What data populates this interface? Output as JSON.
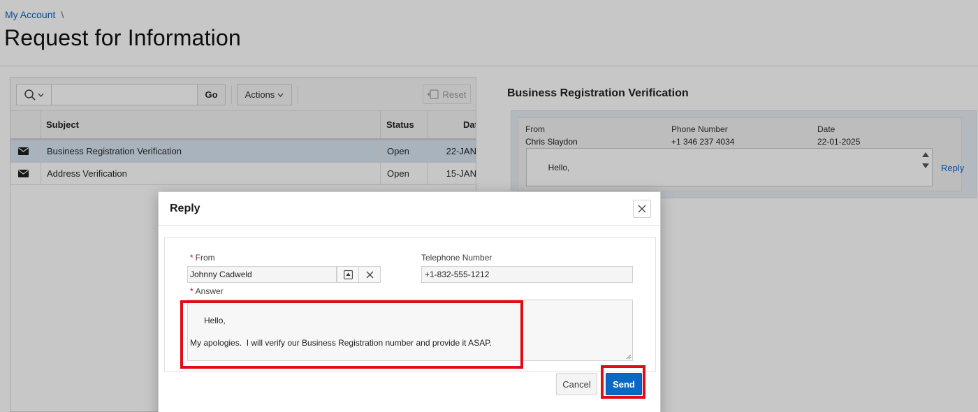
{
  "breadcrumb": {
    "link": "My Account",
    "separator": "\\"
  },
  "page_title": "Request for Information",
  "toolbar": {
    "search_placeholder": "",
    "go_label": "Go",
    "actions_label": "Actions",
    "reset_label": "Reset"
  },
  "grid": {
    "columns": [
      "",
      "Subject",
      "Status",
      "Dat"
    ],
    "rows": [
      {
        "subject": "Business Registration Verification",
        "status": "Open",
        "date": "22-JAN"
      },
      {
        "subject": "Address Verification",
        "status": "Open",
        "date": "15-JAN"
      }
    ]
  },
  "detail": {
    "title": "Business Registration Verification",
    "labels": {
      "from": "From",
      "phone": "Phone Number",
      "date": "Date"
    },
    "from": "Chris Slaydon",
    "phone": "+1 346 237 4034",
    "date": "22-01-2025",
    "message": "Hello,\n\nCould you please verify the Business Registration number provided?  The number provided during the",
    "reply_link": "Reply"
  },
  "dialog": {
    "title": "Reply",
    "from_label": "From",
    "from_value": "Johnny Cadweld",
    "tel_label": "Telephone Number",
    "tel_value": "+1-832-555-1212",
    "answer_label": "Answer",
    "answer_value": "Hello,\n\nMy apologies.  I will verify our Business Registration number and provide it ASAP.\n\nThank you!",
    "cancel_label": "Cancel",
    "send_label": "Send",
    "required_marker": "*"
  },
  "colors": {
    "accent": "#0a68c5",
    "link": "#0b64c0",
    "highlight": "#e10d16",
    "selected_row": "#d9e6f3"
  },
  "icons": [
    "search-icon",
    "chevron-down-icon",
    "reset-icon",
    "mail-icon",
    "close-icon",
    "popup-lov-icon",
    "clear-icon",
    "scroll-up-icon",
    "scroll-down-icon",
    "resize-grip-icon"
  ]
}
